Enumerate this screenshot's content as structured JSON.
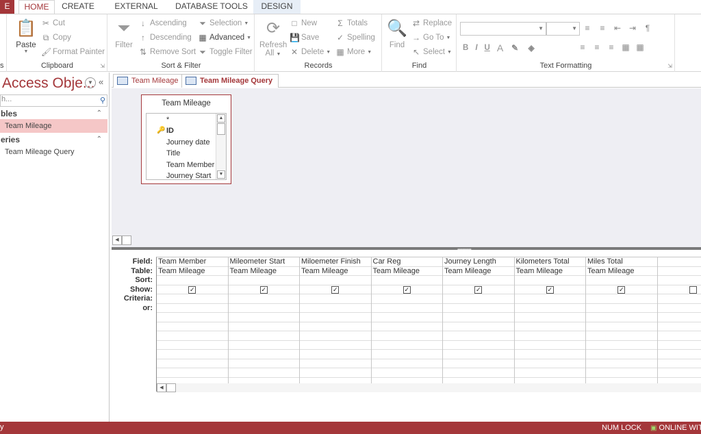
{
  "ribbon_tabs": {
    "file": "E",
    "home": "HOME",
    "create": "CREATE",
    "external": "EXTERNAL DATA",
    "dbtools": "DATABASE TOOLS",
    "design": "DESIGN"
  },
  "clipboard": {
    "paste": "Paste",
    "cut": "Cut",
    "copy": "Copy",
    "format_painter": "Format Painter",
    "label": "Clipboard",
    "views_label": "s"
  },
  "sort_filter": {
    "filter": "Filter",
    "ascending": "Ascending",
    "descending": "Descending",
    "remove_sort": "Remove Sort",
    "selection": "Selection",
    "advanced": "Advanced",
    "toggle_filter": "Toggle Filter",
    "label": "Sort & Filter"
  },
  "records": {
    "refresh": "Refresh",
    "all": "All",
    "new": "New",
    "save": "Save",
    "delete": "Delete",
    "totals": "Totals",
    "spelling": "Spelling",
    "more": "More",
    "label": "Records"
  },
  "find": {
    "find": "Find",
    "replace": "Replace",
    "goto": "Go To",
    "select": "Select",
    "label": "Find"
  },
  "text_formatting": {
    "bold": "B",
    "italic": "I",
    "underline": "U",
    "font_color": "A",
    "label": "Text Formatting"
  },
  "nav": {
    "title": "Access Obje...",
    "search_placeholder": "h...",
    "tables_group": "bles",
    "queries_group": "eries",
    "table_item": "Team Mileage",
    "query_item": "Team Mileage Query"
  },
  "doc_tabs": {
    "tab1": "Team Mileage",
    "tab2": "Team Mileage Query"
  },
  "table_box": {
    "title": "Team Mileage",
    "fields": [
      "*",
      "ID",
      "Journey date",
      "Title",
      "Team Member",
      "Journey Start"
    ]
  },
  "grid": {
    "row_labels": {
      "field": "Field:",
      "table": "Table:",
      "sort": "Sort:",
      "show": "Show:",
      "criteria": "Criteria:",
      "or": "or:"
    },
    "columns": [
      {
        "field": "Team Member",
        "table": "Team Mileage",
        "show": true
      },
      {
        "field": "Mileometer Start",
        "table": "Team Mileage",
        "show": true
      },
      {
        "field": "Miloemeter Finish",
        "table": "Team Mileage",
        "show": true
      },
      {
        "field": "Car Reg",
        "table": "Team Mileage",
        "show": true
      },
      {
        "field": "Journey Length",
        "table": "Team Mileage",
        "show": true
      },
      {
        "field": "Kilometers Total",
        "table": "Team Mileage",
        "show": true
      },
      {
        "field": "Miles Total",
        "table": "Team Mileage",
        "show": true
      },
      {
        "field": "",
        "table": "",
        "show": false
      }
    ]
  },
  "status": {
    "left": "y",
    "numlock": "NUM LOCK",
    "online": "ONLINE WITH"
  },
  "colors": {
    "accent": "#a4373a",
    "selected_nav": "#f5c7c7",
    "query_bg": "#eeeef3"
  }
}
